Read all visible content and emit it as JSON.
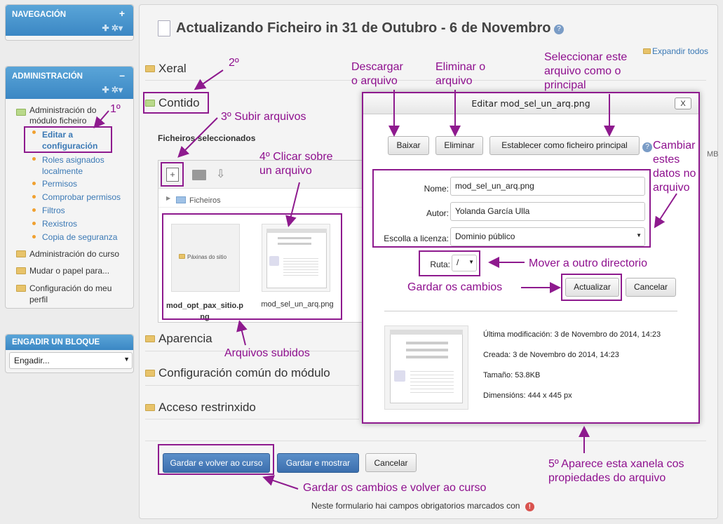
{
  "sidebar": {
    "nav_title": "NAVEGACIÓN",
    "adm_title": "ADMINISTRACIÓN",
    "adm_items": {
      "module_admin": "Administración do",
      "module_admin2": "módulo ficheiro",
      "edit_settings": "Editar a",
      "edit_settings2": "configuración",
      "roles": "Roles asignados",
      "roles2": "localmente",
      "permissions": "Permisos",
      "check_perms": "Comprobar permisos",
      "filters": "Filtros",
      "logs": "Rexistros",
      "backup": "Copia de seguranza",
      "course_admin": "Administración do curso",
      "switch_role": "Mudar o papel para...",
      "profile": "Configuración do meu",
      "profile2": "perfil"
    },
    "add_block_title": "ENGADIR UN BLOQUE",
    "add_block_select": "Engadir..."
  },
  "main": {
    "page_title": "Actualizando Ficheiro in 31 de Outubro - 6 de Novembro",
    "expand_all": "Expandir todos",
    "sections": {
      "xeral": "Xeral",
      "contido": "Contido",
      "aparencia": "Aparencia",
      "config_comun": "Configuración común do módulo",
      "acceso": "Acceso restrinxido"
    },
    "selected_files_label": "Ficheiros seleccionados",
    "breadcrumb_folder": "Ficheiros",
    "files": [
      {
        "name": "mod_opt_pax_sitio.p",
        "name2": "ng",
        "thumb_text": "Páxinas do sitio"
      },
      {
        "name": "mod_sel_un_arq.png"
      }
    ],
    "size_hint": "MB",
    "buttons": {
      "save_return": "Gardar e volver ao curso",
      "save_show": "Gardar e mostrar",
      "cancel": "Cancelar"
    },
    "required_note": "Neste formulario hai campos obrigatorios marcados con"
  },
  "dialog": {
    "title": "Editar mod_sel_un_arq.png",
    "close": "X",
    "download": "Baixar",
    "delete": "Eliminar",
    "set_main": "Establecer como ficheiro principal",
    "name_label": "Nome:",
    "name_value": "mod_sel_un_arq.png",
    "author_label": "Autor:",
    "author_value": "Yolanda García Ulla",
    "license_label": "Escolla a licenza:",
    "license_value": "Dominio público",
    "path_label": "Ruta:",
    "path_value": "/",
    "update": "Actualizar",
    "cancel": "Cancelar",
    "last_modified": "Última modificación: 3 de Novembro do 2014, 14:23",
    "created": "Creada: 3 de Novembro do 2014, 14:23",
    "size": "Tamaño: 53.8KB",
    "dimensions": "Dimensións: 444 x 445 px"
  },
  "annotations": {
    "a1": "1º",
    "a2": "2º",
    "a3": "3º  Subir arquivos",
    "a4a": "4º  Clicar sobre",
    "a4b": "un arquivo",
    "download_a": "Descargar",
    "download_b": "o arquivo",
    "delete_a": "Eliminar o",
    "delete_b": "arquivo",
    "select_a": "Seleccionar este",
    "select_b": "arquivo como o",
    "select_c": "principal",
    "change_a": "Cambiar",
    "change_b": "estes",
    "change_c": "datos no",
    "change_d": "arquivo",
    "move": "Mover a outro directorio",
    "save_changes": "Gardar os cambios",
    "uploaded": "Arquivos subidos",
    "save_return": "Gardar os cambios e volver ao curso",
    "appears_a": "5º  Aparece esta xanela cos",
    "appears_b": "propiedades do arquivo"
  },
  "colors": {
    "annotation": "#8e1a8e",
    "block_header": "#3b87c4",
    "primary_button": "#3c6fae"
  }
}
